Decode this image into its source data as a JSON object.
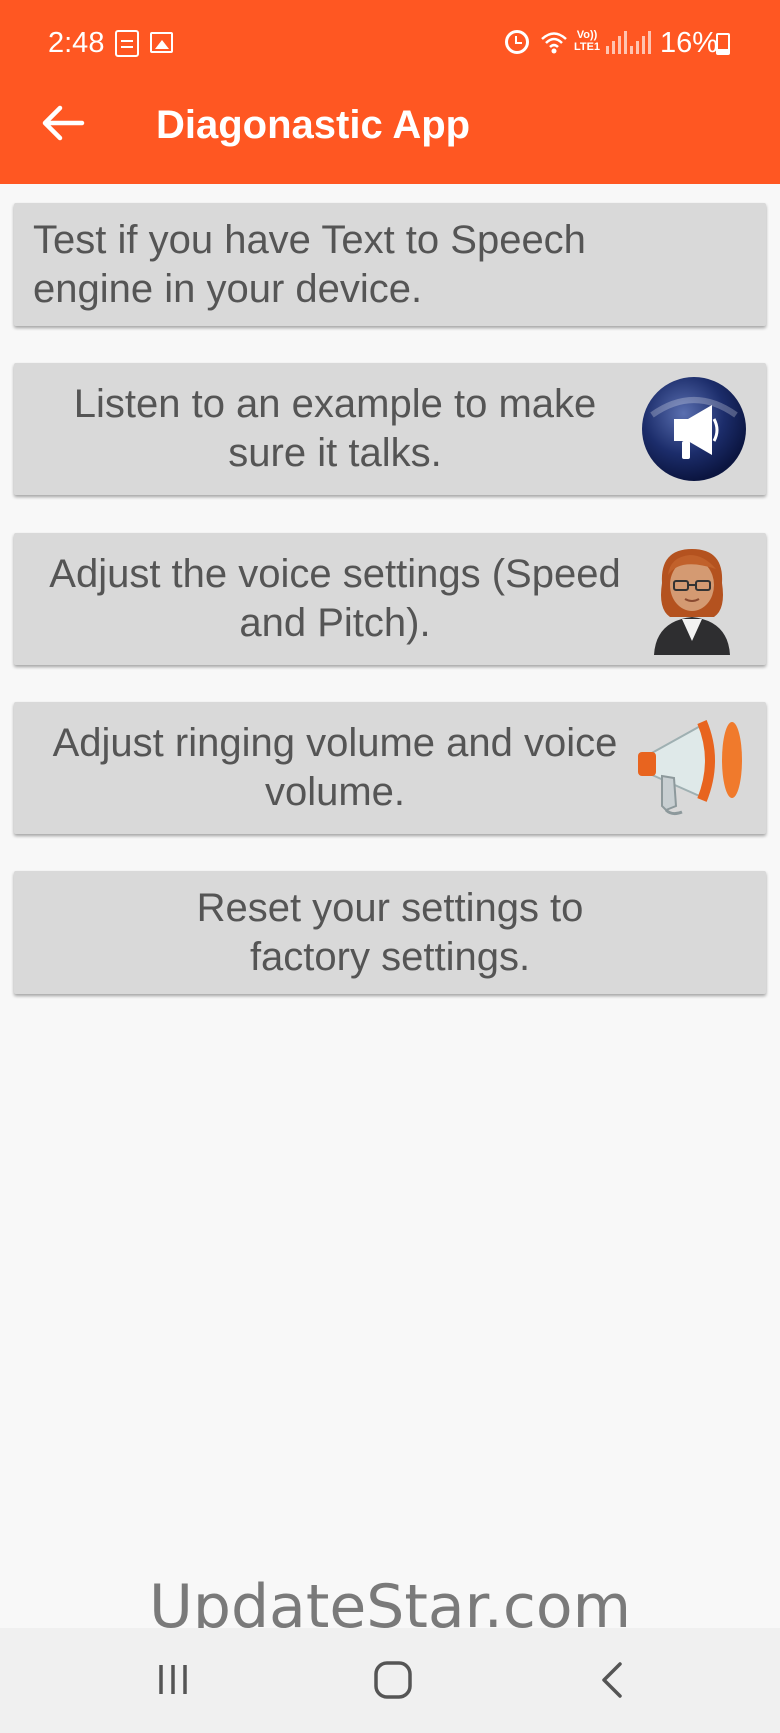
{
  "status_bar": {
    "time": "2:48",
    "network_label": "Vo)) LTE1",
    "battery": "16%"
  },
  "app_bar": {
    "title": "Diagonastic App",
    "background": "#ff5722"
  },
  "menu": [
    {
      "text": "Test if you have Text to Speech engine in your device.",
      "icon": ""
    },
    {
      "text": "Listen to an example to make sure it talks.",
      "icon": "megaphone-circle-icon"
    },
    {
      "text": "Adjust the voice settings (Speed and Pitch).",
      "icon": "woman-avatar-icon"
    },
    {
      "text": "Adjust ringing volume and voice volume.",
      "icon": "megaphone-icon"
    },
    {
      "text": "Reset your settings to factory settings.",
      "icon": ""
    }
  ],
  "watermark": "UpdateStar.com"
}
